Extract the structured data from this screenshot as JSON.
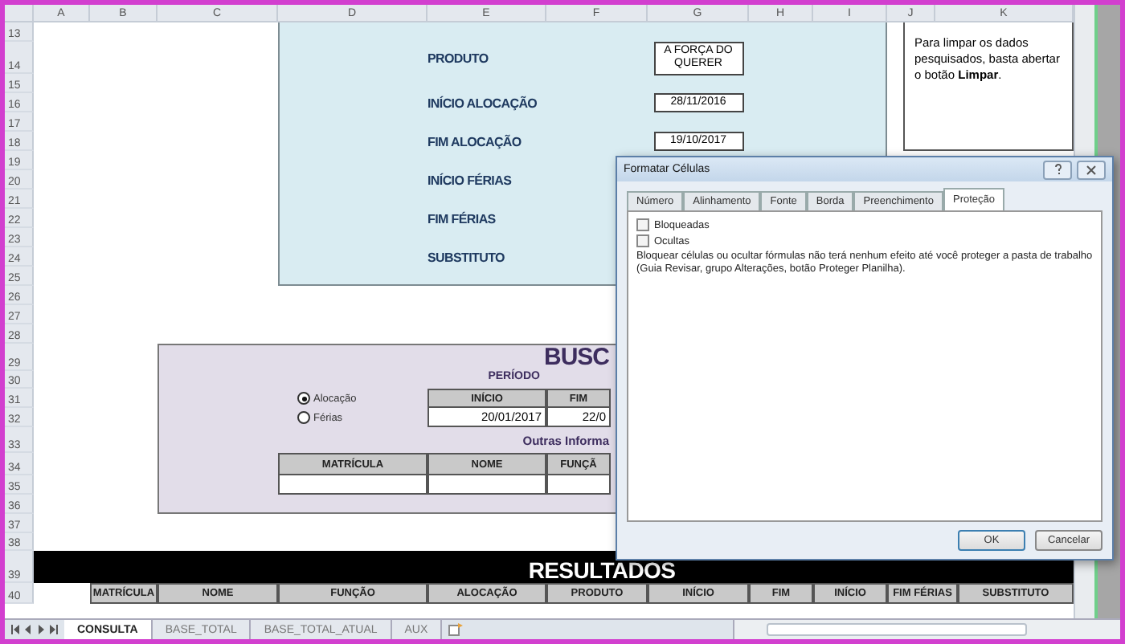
{
  "column_headers": [
    "A",
    "B",
    "C",
    "D",
    "E",
    "F",
    "G",
    "H",
    "I",
    "J",
    "K"
  ],
  "row_numbers": [
    "13",
    "14",
    "15",
    "16",
    "17",
    "18",
    "19",
    "20",
    "21",
    "22",
    "23",
    "24",
    "25",
    "26",
    "27",
    "28",
    "29",
    "30",
    "31",
    "32",
    "33",
    "34",
    "35",
    "36",
    "37",
    "38",
    "39",
    "40"
  ],
  "details_panel": {
    "fields": [
      {
        "label": "PRODUTO",
        "value": "A FORÇA DO QUERER"
      },
      {
        "label": "INÍCIO ALOCAÇÃO",
        "value": "28/11/2016"
      },
      {
        "label": "FIM ALOCAÇÃO",
        "value": "19/10/2017"
      },
      {
        "label": "INÍCIO FÉRIAS"
      },
      {
        "label": "FIM FÉRIAS"
      },
      {
        "label": "SUBSTITUTO"
      }
    ]
  },
  "note": "Para limpar os dados pesquisados, basta abertar o botão **Limpar**.",
  "search_panel": {
    "title": "BUSC",
    "period_label": "PERÍODO",
    "mode_options": [
      {
        "label": "Alocação",
        "selected": true
      },
      {
        "label": "Férias",
        "selected": false
      }
    ],
    "period_columns": [
      "INÍCIO",
      "FIM"
    ],
    "period_values": [
      "20/01/2017",
      "22/0"
    ],
    "other_info_label": "Outras Informa",
    "other_columns": [
      "MATRÍCULA",
      "NOME",
      "FUNÇÃ"
    ]
  },
  "results": {
    "title": "RESULTADOS",
    "columns": [
      "MATRÍCULA",
      "NOME",
      "FUNÇÃO",
      "ALOCAÇÃO",
      "PRODUTO",
      "INÍCIO",
      "FIM",
      "INÍCIO",
      "FIM FÉRIAS",
      "SUBSTITUTO"
    ]
  },
  "sheet_tabs": [
    {
      "label": "CONSULTA",
      "selected": true
    },
    {
      "label": "BASE_TOTAL",
      "selected": false
    },
    {
      "label": "BASE_TOTAL_ATUAL",
      "selected": false
    },
    {
      "label": "AUX",
      "selected": false
    }
  ],
  "dialog": {
    "title": "Formatar Células",
    "tabs": [
      {
        "label": "Número",
        "selected": false
      },
      {
        "label": "Alinhamento",
        "selected": false
      },
      {
        "label": "Fonte",
        "selected": false
      },
      {
        "label": "Borda",
        "selected": false
      },
      {
        "label": "Preenchimento",
        "selected": false
      },
      {
        "label": "Proteção",
        "selected": true
      }
    ],
    "options": [
      {
        "label": "Bloqueadas",
        "checked": false
      },
      {
        "label": "Ocultas",
        "checked": false
      }
    ],
    "description": "Bloquear células ou ocultar fórmulas não terá nenhum efeito até você proteger a pasta de trabalho (Guia Revisar, grupo Alterações, botão Proteger Planilha).",
    "buttons": [
      "OK",
      "Cancelar"
    ]
  }
}
